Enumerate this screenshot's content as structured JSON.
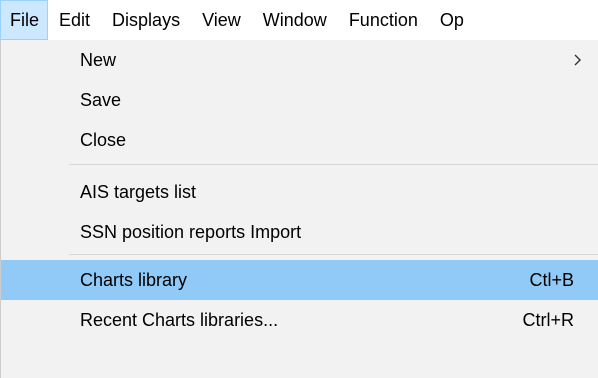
{
  "menubar": {
    "items": [
      {
        "label": "File"
      },
      {
        "label": "Edit"
      },
      {
        "label": "Displays"
      },
      {
        "label": "View"
      },
      {
        "label": "Window"
      },
      {
        "label": "Function"
      },
      {
        "label": "Op"
      }
    ]
  },
  "file_menu": {
    "new": {
      "label": "New",
      "submenu_icon": "chevron-right-icon"
    },
    "save": {
      "label": "Save"
    },
    "close": {
      "label": "Close"
    },
    "ais_targets": {
      "label": "AIS targets list"
    },
    "ssn_import": {
      "label": "SSN position reports Import"
    },
    "charts_library": {
      "label": "Charts library",
      "shortcut": "Ctl+B"
    },
    "recent_charts": {
      "label": "Recent Charts libraries...",
      "shortcut": "Ctrl+R"
    }
  },
  "colors": {
    "active_menu_bg": "#cce8ff",
    "highlight_bg": "#91c9f7",
    "dropdown_bg": "#f2f2f2"
  }
}
